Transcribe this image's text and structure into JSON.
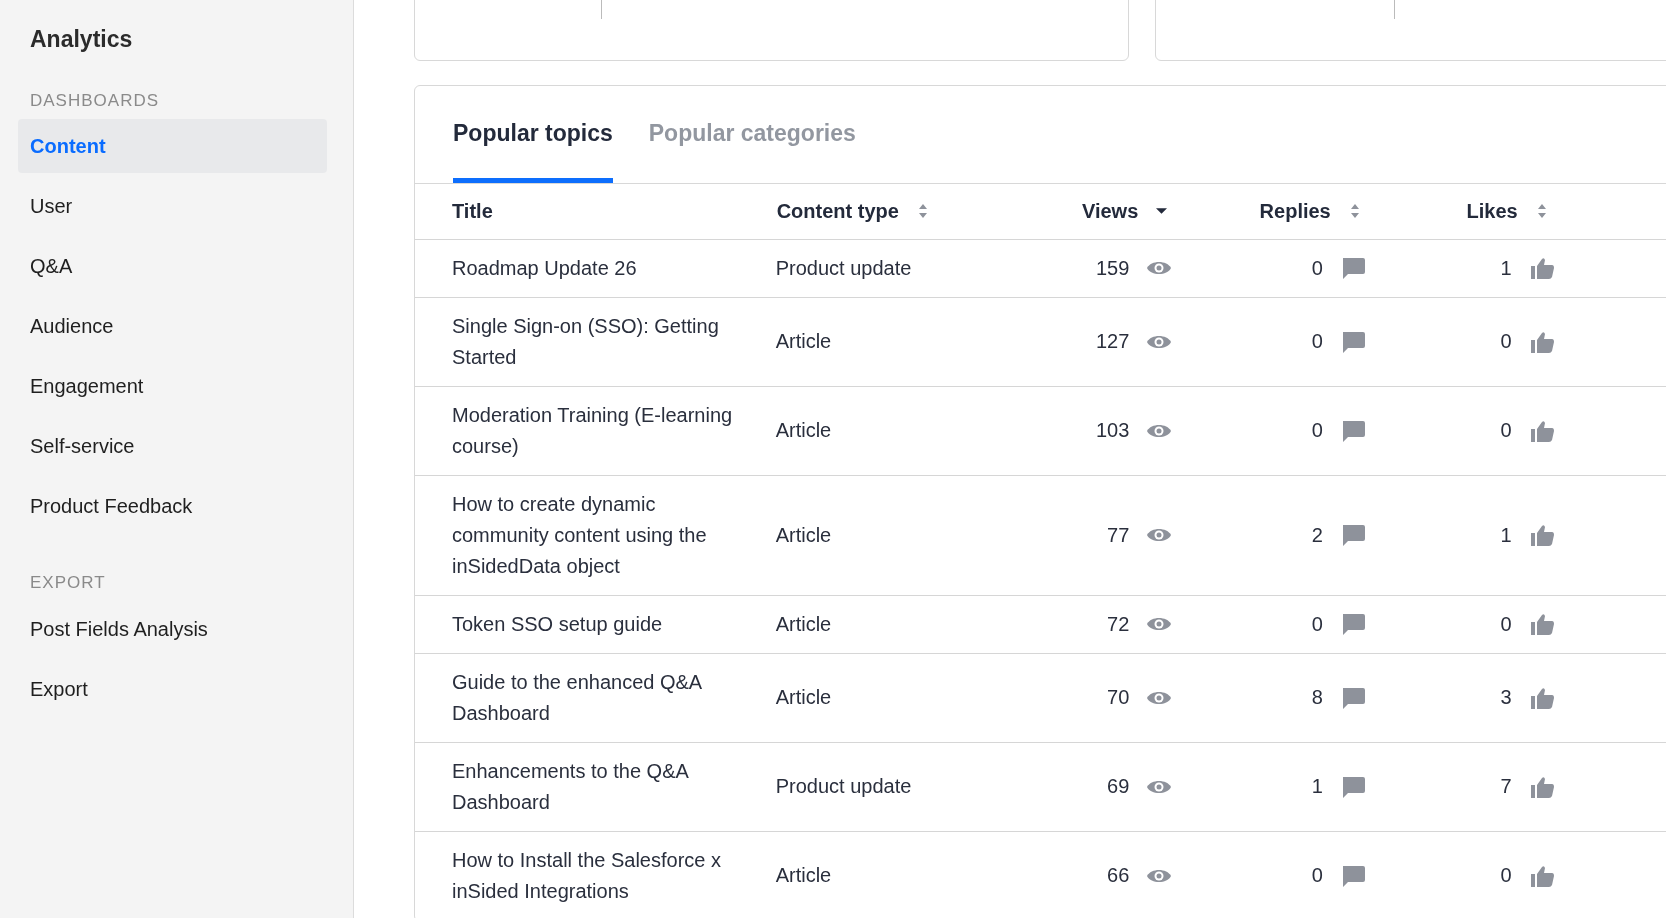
{
  "sidebar": {
    "title": "Analytics",
    "sections": [
      {
        "heading": "DASHBOARDS",
        "items": [
          {
            "label": "Content",
            "selected": true
          },
          {
            "label": "User",
            "selected": false
          },
          {
            "label": "Q&A",
            "selected": false
          },
          {
            "label": "Audience",
            "selected": false
          },
          {
            "label": "Engagement",
            "selected": false
          },
          {
            "label": "Self-service",
            "selected": false
          },
          {
            "label": "Product Feedback",
            "selected": false
          }
        ]
      },
      {
        "heading": "EXPORT",
        "items": [
          {
            "label": "Post Fields Analysis",
            "selected": false
          },
          {
            "label": "Export",
            "selected": false
          }
        ]
      }
    ]
  },
  "tabs": [
    {
      "label": "Popular topics",
      "selected": true
    },
    {
      "label": "Popular categories",
      "selected": false
    }
  ],
  "table": {
    "columns": [
      {
        "label": "Title",
        "kind": "plain"
      },
      {
        "label": "Content type",
        "kind": "sortable"
      },
      {
        "label": "Views",
        "kind": "sorted"
      },
      {
        "label": "Replies",
        "kind": "sortable"
      },
      {
        "label": "Likes",
        "kind": "sortable"
      }
    ],
    "rows": [
      {
        "title": "Roadmap Update 26",
        "content_type": "Product update",
        "views": "159",
        "replies": "0",
        "likes": "1"
      },
      {
        "title": "Single Sign-on (SSO): Getting Started",
        "content_type": "Article",
        "views": "127",
        "replies": "0",
        "likes": "0"
      },
      {
        "title": "Moderation Training (E-learning course)",
        "content_type": "Article",
        "views": "103",
        "replies": "0",
        "likes": "0"
      },
      {
        "title": "How to create dynamic community content using the inSidedData object",
        "content_type": "Article",
        "views": "77",
        "replies": "2",
        "likes": "1"
      },
      {
        "title": "Token SSO setup guide",
        "content_type": "Article",
        "views": "72",
        "replies": "0",
        "likes": "0"
      },
      {
        "title": "Guide to the enhanced Q&A Dashboard",
        "content_type": "Article",
        "views": "70",
        "replies": "8",
        "likes": "3"
      },
      {
        "title": "Enhancements to the Q&A Dashboard",
        "content_type": "Product update",
        "views": "69",
        "replies": "1",
        "likes": "7"
      },
      {
        "title": "How to Install the Salesforce x inSided Integrations",
        "content_type": "Article",
        "views": "66",
        "replies": "0",
        "likes": "0"
      }
    ]
  }
}
